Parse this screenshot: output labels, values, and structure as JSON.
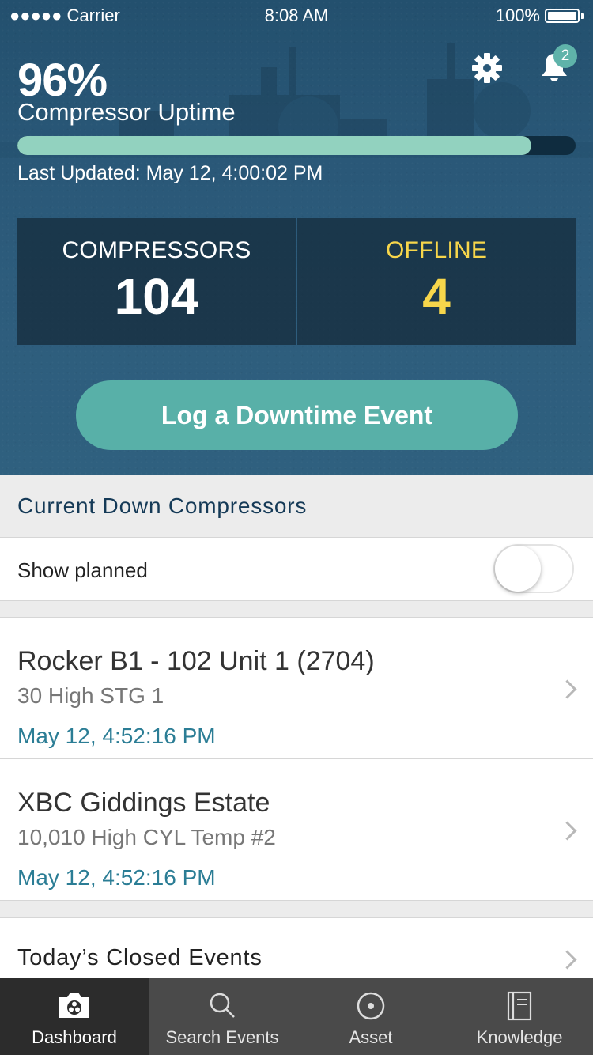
{
  "status_bar": {
    "carrier": "●●●●● Carrier",
    "time": "8:08 AM",
    "battery": "100%"
  },
  "header": {
    "uptime_value": "96%",
    "uptime_label": "Compressor Uptime",
    "uptime_progress": 0.92,
    "last_updated": "Last Updated: May 12, 4:00:02 PM",
    "notification_count": "2"
  },
  "stats": {
    "compressors_label": "COMPRESSORS",
    "compressors_value": "104",
    "offline_label": "OFFLINE",
    "offline_value": "4"
  },
  "log_button_label": "Log a Downtime Event",
  "section": {
    "title": "Current Down Compressors",
    "show_planned_label": "Show planned",
    "show_planned_on": false
  },
  "down_list": [
    {
      "title": "Rocker B1 - 102 Unit 1 (2704)",
      "subtitle": "30 High STG 1",
      "date": "May 12, 4:52:16 PM"
    },
    {
      "title": "XBC Giddings Estate",
      "subtitle": "10,010 High CYL Temp #2",
      "date": "May 12, 4:52:16 PM"
    }
  ],
  "closed_events_label": "Today’s Closed Events",
  "tabs": [
    {
      "label": "Dashboard",
      "icon": "dashboard-camera-icon",
      "active": true
    },
    {
      "label": "Search Events",
      "icon": "search-icon",
      "active": false
    },
    {
      "label": "Asset",
      "icon": "asset-target-icon",
      "active": false
    },
    {
      "label": "Knowledge",
      "icon": "knowledge-book-icon",
      "active": false
    }
  ],
  "colors": {
    "hero": "#2a5878",
    "accent_teal": "#58b0a8",
    "progress_fill": "#92d2bf",
    "offline_yellow": "#f7d64b",
    "date_blue": "#2b7d95"
  }
}
